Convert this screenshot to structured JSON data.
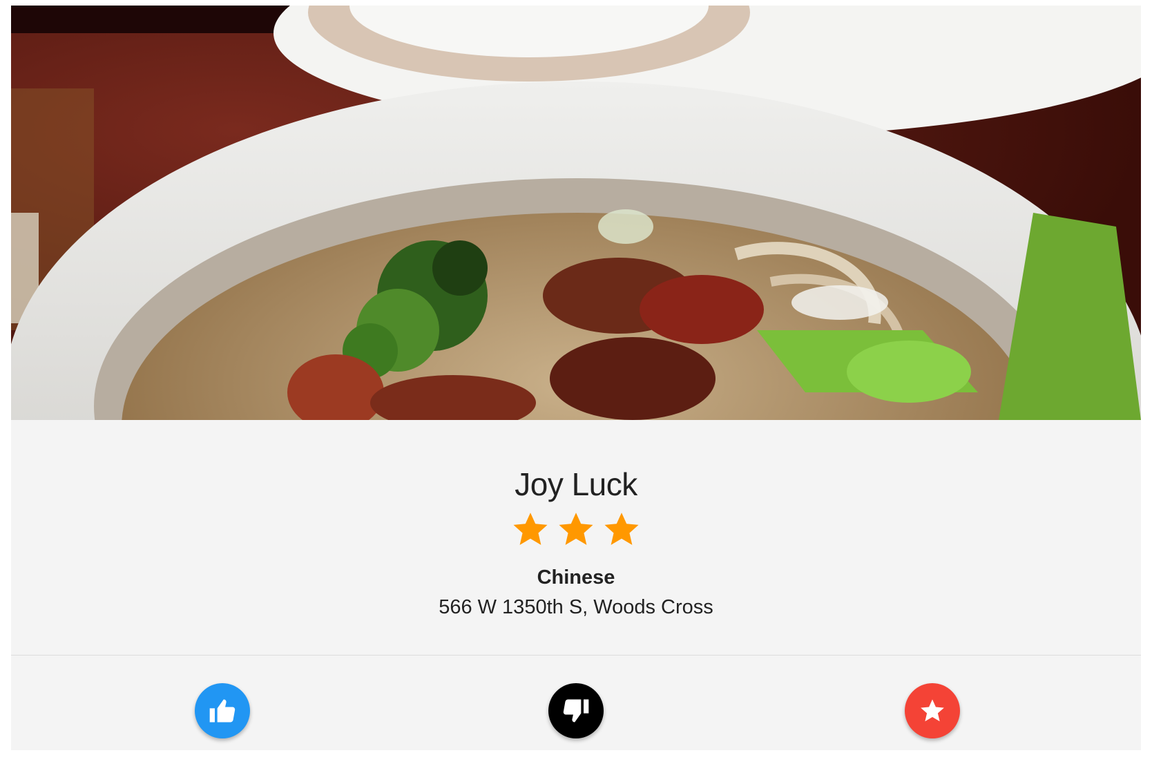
{
  "restaurant": {
    "name": "Joy Luck",
    "rating": 3,
    "cuisine": "Chinese",
    "address": "566 W 1350th S, Woods Cross"
  },
  "photo": {
    "icon": "food-photo"
  },
  "actions": [
    {
      "name": "like",
      "icon": "thumbs-up-icon",
      "color": "#2196f3"
    },
    {
      "name": "dislike",
      "icon": "thumbs-down-icon",
      "color": "#000000"
    },
    {
      "name": "favorite",
      "icon": "star-icon",
      "color": "#f44336"
    }
  ],
  "colors": {
    "star": "#ff9800",
    "card_bg": "#f4f4f4",
    "text": "#222222"
  }
}
